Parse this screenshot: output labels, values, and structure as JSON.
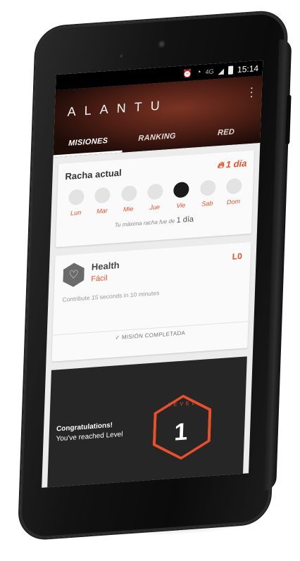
{
  "status": {
    "network": "4G",
    "time": "15:14"
  },
  "app": {
    "brand": "ALANTU"
  },
  "tabs": [
    {
      "label": "MISIONES",
      "active": true
    },
    {
      "label": "RANKING",
      "active": false
    },
    {
      "label": "RED",
      "active": false
    }
  ],
  "streak": {
    "title": "Racha actual",
    "count": "1 día",
    "days": [
      {
        "label": "Lun",
        "done": false
      },
      {
        "label": "Mar",
        "done": false
      },
      {
        "label": "Mie",
        "done": false
      },
      {
        "label": "Jue",
        "done": false
      },
      {
        "label": "Vie",
        "done": true
      },
      {
        "label": "Sab",
        "done": false
      },
      {
        "label": "Dom",
        "done": false
      }
    ],
    "note_prefix": "Tu máxima racha fue de",
    "note_value": "1 día"
  },
  "mission": {
    "title": "Health",
    "difficulty": "Fácil",
    "level": "L0",
    "description": "Contribute 15 seconds in 10 minutes",
    "status": "✓ MISIÓN COMPLETADA"
  },
  "level_card": {
    "title": "Congratulations!",
    "subtitle": "You've reached Level",
    "badge_word": "LEVEL",
    "badge_number": "1"
  },
  "colors": {
    "accent": "#e8502b",
    "dark": "#1b1b1b",
    "background": "#ececec"
  }
}
